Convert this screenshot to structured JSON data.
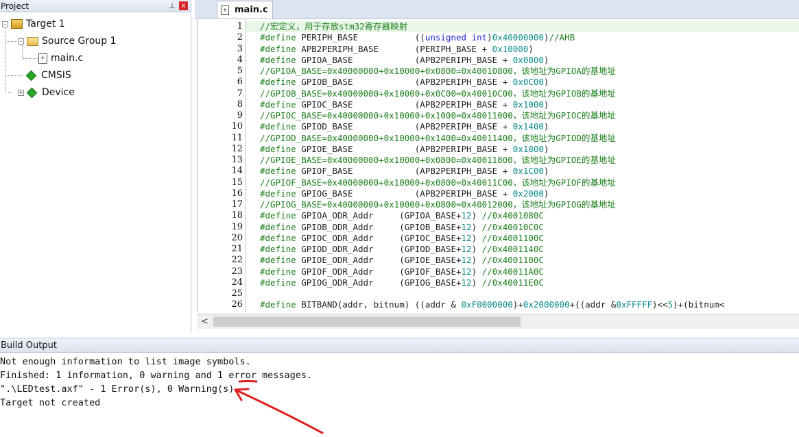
{
  "project_panel": {
    "title": "Project",
    "pin_glyph": "⊥",
    "close_glyph": "x",
    "tree": [
      {
        "label": "Target 1",
        "expander": "-",
        "icon": "target-icon"
      },
      {
        "label": "Source Group 1",
        "expander": "-",
        "icon": "folder-icon"
      },
      {
        "label": "main.c",
        "expander": "",
        "icon": "c-file-icon"
      },
      {
        "label": "CMSIS",
        "expander": "",
        "icon": "component-icon"
      },
      {
        "label": "Device",
        "expander": "+",
        "icon": "component-icon"
      }
    ]
  },
  "editor": {
    "tab_label": "main.c",
    "lines": [
      {
        "n": "1",
        "parts": [
          [
            "cmt",
            "//宏定义，用于存放stm32寄存器映射"
          ]
        ]
      },
      {
        "n": "2",
        "parts": [
          [
            "cmt",
            "#define"
          ],
          [
            "",
            " PERIPH_BASE           (("
          ],
          [
            "kw",
            "unsigned int"
          ],
          [
            "",
            ")"
          ],
          [
            "num",
            "0x40000000"
          ],
          [
            "",
            ")"
          ],
          [
            "cmt",
            "//AHB"
          ]
        ]
      },
      {
        "n": "3",
        "parts": [
          [
            "cmt",
            "#define"
          ],
          [
            "",
            " APB2PERIPH_BASE       (PERIPH_BASE + "
          ],
          [
            "num",
            "0x10000"
          ],
          [
            "",
            ")"
          ]
        ]
      },
      {
        "n": "4",
        "parts": [
          [
            "cmt",
            "#define"
          ],
          [
            "",
            " GPIOA_BASE            (APB2PERIPH_BASE + "
          ],
          [
            "num",
            "0x0800"
          ],
          [
            "",
            ")"
          ]
        ]
      },
      {
        "n": "5",
        "parts": [
          [
            "cmt",
            "//GPIOA_BASE=0x40000000+0x10000+0x0800=0x40010800，该地址为GPIOA的基地址"
          ]
        ]
      },
      {
        "n": "6",
        "parts": [
          [
            "cmt",
            "#define"
          ],
          [
            "",
            " GPIOB_BASE            (APB2PERIPH_BASE + "
          ],
          [
            "num",
            "0x0C00"
          ],
          [
            "",
            ")"
          ]
        ]
      },
      {
        "n": "7",
        "parts": [
          [
            "cmt",
            "//GPIOB_BASE=0x40000000+0x10000+0x0C00=0x40010C00，该地址为GPIOB的基地址"
          ]
        ]
      },
      {
        "n": "8",
        "parts": [
          [
            "cmt",
            "#define"
          ],
          [
            "",
            " GPIOC_BASE            (APB2PERIPH_BASE + "
          ],
          [
            "num",
            "0x1000"
          ],
          [
            "",
            ")"
          ]
        ]
      },
      {
        "n": "9",
        "parts": [
          [
            "cmt",
            "//GPIOC_BASE=0x40000000+0x10000+0x1000=0x40011000，该地址为GPIOC的基地址"
          ]
        ]
      },
      {
        "n": "10",
        "parts": [
          [
            "cmt",
            "#define"
          ],
          [
            "",
            " GPIOD_BASE            (APB2PERIPH_BASE + "
          ],
          [
            "num",
            "0x1400"
          ],
          [
            "",
            ")"
          ]
        ]
      },
      {
        "n": "11",
        "parts": [
          [
            "cmt",
            "//GPIOD_BASE=0x40000000+0x10000+0x1400=0x40011400，该地址为GPIOD的基地址"
          ]
        ]
      },
      {
        "n": "12",
        "parts": [
          [
            "cmt",
            "#define"
          ],
          [
            "",
            " GPIOE_BASE            (APB2PERIPH_BASE + "
          ],
          [
            "num",
            "0x1800"
          ],
          [
            "",
            ")"
          ]
        ]
      },
      {
        "n": "13",
        "parts": [
          [
            "cmt",
            "//GPIOE_BASE=0x40000000+0x10000+0x0800=0x40011800，该地址为GPIOE的基地址"
          ]
        ]
      },
      {
        "n": "14",
        "parts": [
          [
            "cmt",
            "#define"
          ],
          [
            "",
            " GPIOF_BASE            (APB2PERIPH_BASE + "
          ],
          [
            "num",
            "0x1C00"
          ],
          [
            "",
            ")"
          ]
        ]
      },
      {
        "n": "15",
        "parts": [
          [
            "cmt",
            "//GPIOF_BASE=0x40000000+0x10000+0x0800=0x40011C00，该地址为GPIOF的基地址"
          ]
        ]
      },
      {
        "n": "16",
        "parts": [
          [
            "cmt",
            "#define"
          ],
          [
            "",
            " GPIOG_BASE            (APB2PERIPH_BASE + "
          ],
          [
            "num",
            "0x2000"
          ],
          [
            "",
            ")"
          ]
        ]
      },
      {
        "n": "17",
        "parts": [
          [
            "cmt",
            "//GPIOG_BASE=0x40000000+0x10000+0x0800=0x40012000，该地址为GPIOG的基地址"
          ]
        ]
      },
      {
        "n": "18",
        "parts": [
          [
            "cmt",
            "#define"
          ],
          [
            "",
            " GPIOA_ODR_Addr     (GPIOA_BASE+"
          ],
          [
            "num",
            "12"
          ],
          [
            "",
            ") "
          ],
          [
            "cmt",
            "//0x4001080C"
          ]
        ]
      },
      {
        "n": "19",
        "parts": [
          [
            "cmt",
            "#define"
          ],
          [
            "",
            " GPIOB_ODR_Addr     (GPIOB_BASE+"
          ],
          [
            "num",
            "12"
          ],
          [
            "",
            ") "
          ],
          [
            "cmt",
            "//0x40010C0C"
          ]
        ]
      },
      {
        "n": "20",
        "parts": [
          [
            "cmt",
            "#define"
          ],
          [
            "",
            " GPIOC_ODR_Addr     (GPIOC_BASE+"
          ],
          [
            "num",
            "12"
          ],
          [
            "",
            ") "
          ],
          [
            "cmt",
            "//0x4001100C"
          ]
        ]
      },
      {
        "n": "21",
        "parts": [
          [
            "cmt",
            "#define"
          ],
          [
            "",
            " GPIOD_ODR_Addr     (GPIOD_BASE+"
          ],
          [
            "num",
            "12"
          ],
          [
            "",
            ") "
          ],
          [
            "cmt",
            "//0x4001140C"
          ]
        ]
      },
      {
        "n": "22",
        "parts": [
          [
            "cmt",
            "#define"
          ],
          [
            "",
            " GPIOE_ODR_Addr     (GPIOE_BASE+"
          ],
          [
            "num",
            "12"
          ],
          [
            "",
            ") "
          ],
          [
            "cmt",
            "//0x4001180C"
          ]
        ]
      },
      {
        "n": "23",
        "parts": [
          [
            "cmt",
            "#define"
          ],
          [
            "",
            " GPIOF_ODR_Addr     (GPIOF_BASE+"
          ],
          [
            "num",
            "12"
          ],
          [
            "",
            ") "
          ],
          [
            "cmt",
            "//0x40011A0C"
          ]
        ]
      },
      {
        "n": "24",
        "parts": [
          [
            "cmt",
            "#define"
          ],
          [
            "",
            " GPIOG_ODR_Addr     (GPIOG_BASE+"
          ],
          [
            "num",
            "12"
          ],
          [
            "",
            ") "
          ],
          [
            "cmt",
            "//0x40011E0C"
          ]
        ]
      },
      {
        "n": "25",
        "parts": []
      },
      {
        "n": "26",
        "parts": [
          [
            "cmt",
            "#define"
          ],
          [
            "",
            " BITBAND(addr, bitnum) ((addr & "
          ],
          [
            "num",
            "0xF0000000"
          ],
          [
            "",
            ")+"
          ],
          [
            "num",
            "0x2000000"
          ],
          [
            "",
            "+((addr &"
          ],
          [
            "num",
            "0xFFFFF"
          ],
          [
            "",
            ")<<"
          ],
          [
            "num",
            "5"
          ],
          [
            "",
            ")+(bitnum<"
          ]
        ]
      }
    ],
    "scroll_left_glyph": "<"
  },
  "build_output": {
    "title": "Build Output",
    "lines": [
      "Not enough information to list image symbols.",
      "Finished: 1 information, 0 warning and 1 error messages.",
      "\".\\LEDtest.axf\" - 1 Error(s), 0 Warning(s).",
      "Target not created"
    ]
  },
  "colors": {
    "comment": "#1b7e1b",
    "keyword": "#2020d0",
    "number": "#0a8a8a",
    "annotation": "#e02020"
  }
}
